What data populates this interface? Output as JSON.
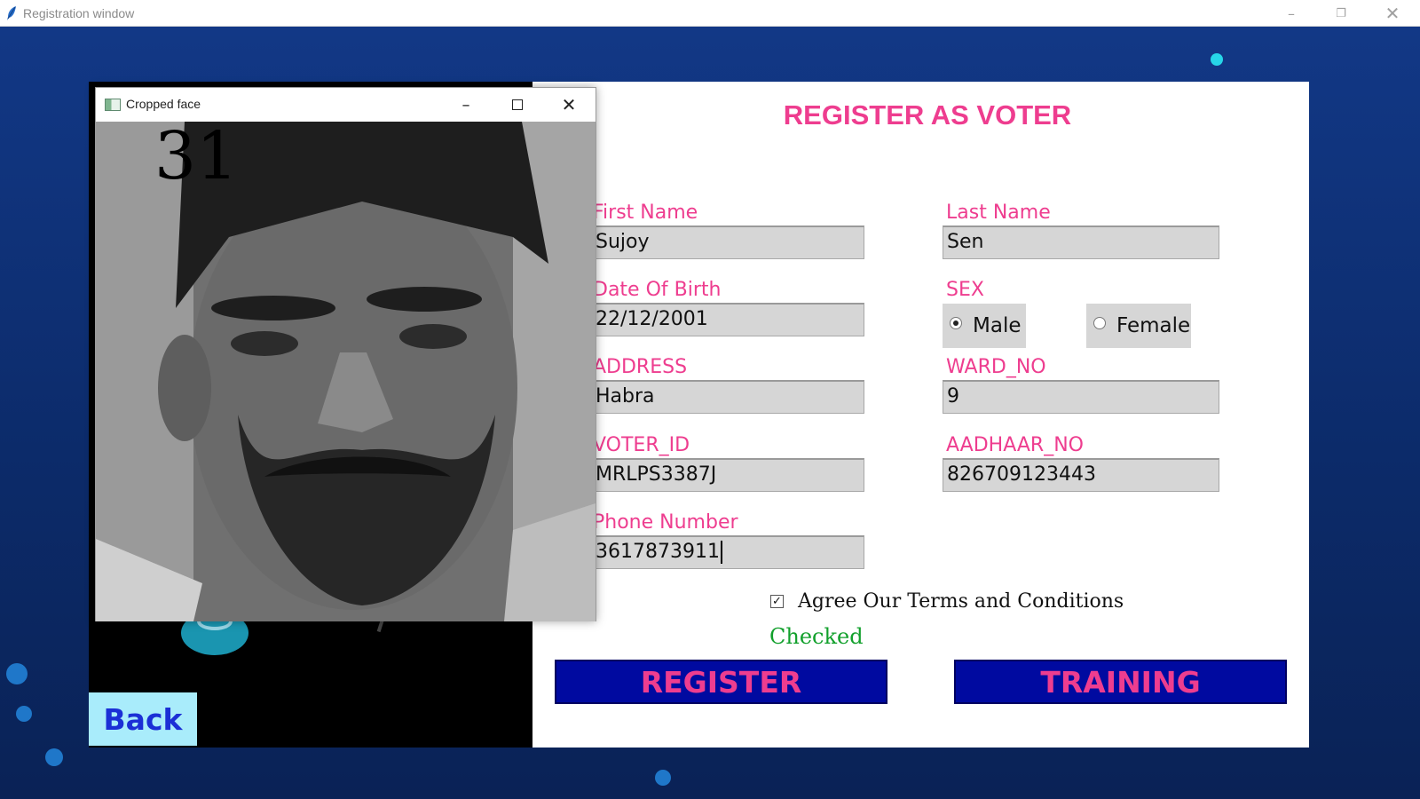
{
  "window": {
    "title": "Registration window"
  },
  "popup": {
    "title": "Cropped face",
    "face_counter": "31"
  },
  "form": {
    "heading": "REGISTER AS VOTER",
    "first_name_label": "First Name",
    "first_name_value": "Sujoy",
    "last_name_label": "Last Name",
    "last_name_value": "Sen",
    "dob_label": "Date Of Birth",
    "dob_value": "22/12/2001",
    "sex_label": "SEX",
    "sex_options": [
      "Male",
      "Female"
    ],
    "sex_selected": "Male",
    "address_label": "ADDRESS",
    "address_value": "Habra",
    "ward_label": "WARD_NO",
    "ward_value": "9",
    "voter_id_label": "VOTER_ID",
    "voter_id_value": "MRLPS3387J",
    "aadhaar_label": "AADHAAR_NO",
    "aadhaar_value": "826709123443",
    "phone_label": "Phone Number",
    "phone_value": "3617873911",
    "terms_label": "Agree Our Terms and Conditions",
    "terms_status": "Checked"
  },
  "buttons": {
    "register": "REGISTER",
    "training": "TRAINING",
    "back": "Back"
  },
  "colors": {
    "accent": "#ee3d8f",
    "button_bg": "#000aa0",
    "back_bg": "#a9ecfb",
    "status_green": "#12a02c"
  }
}
